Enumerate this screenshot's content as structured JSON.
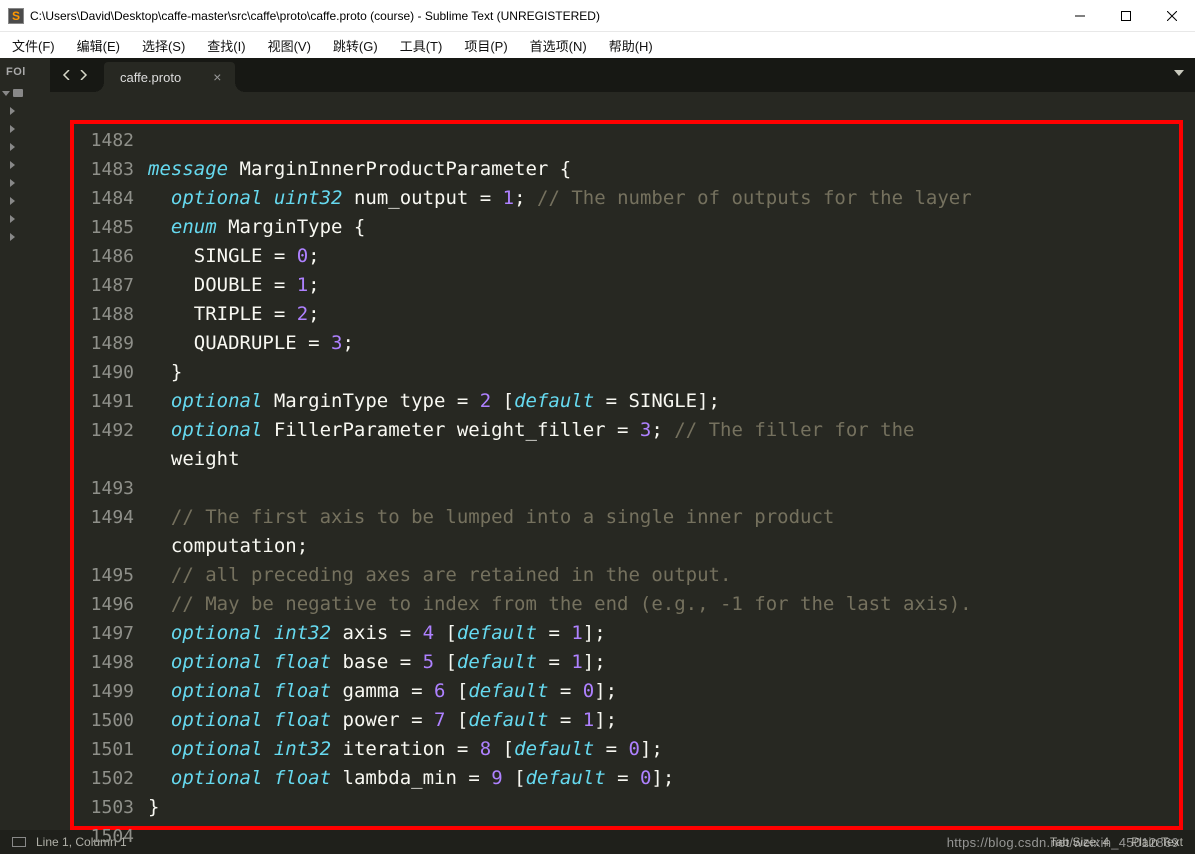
{
  "title": "C:\\Users\\David\\Desktop\\caffe-master\\src\\caffe\\proto\\caffe.proto (course) - Sublime Text (UNREGISTERED)",
  "app_icon_letter": "S",
  "menu": {
    "file": "文件(F)",
    "edit": "编辑(E)",
    "select": "选择(S)",
    "find": "查找(I)",
    "view": "视图(V)",
    "goto": "跳转(G)",
    "tools": "工具(T)",
    "project": "项目(P)",
    "prefs": "首选项(N)",
    "help": "帮助(H)"
  },
  "sidebar_header": "FOl",
  "tab": {
    "name": "caffe.proto"
  },
  "gutter_start": 1482,
  "gutter_end": 1504,
  "code_lines": [
    "",
    "message MarginInnerProductParameter {",
    "  optional uint32 num_output = 1; // The number of outputs for the layer",
    "  enum MarginType {",
    "    SINGLE = 0;",
    "    DOUBLE = 1;",
    "    TRIPLE = 2;",
    "    QUADRUPLE = 3;",
    "  }",
    "  optional MarginType type = 2 [default = SINGLE];",
    "  optional FillerParameter weight_filler = 3; // The filler for the",
    "  weight",
    "",
    "  // The first axis to be lumped into a single inner product",
    "  computation;",
    "  // all preceding axes are retained in the output.",
    "  // May be negative to index from the end (e.g., -1 for the last axis).",
    "  optional int32 axis = 4 [default = 1];",
    "  optional float base = 5 [default = 1];",
    "  optional float gamma = 6 [default = 0];",
    "  optional float power = 7 [default = 1];",
    "  optional int32 iteration = 8 [default = 0];",
    "  optional float lambda_min = 9 [default = 0];",
    "}",
    ""
  ],
  "wrapped_after": {
    "10": true,
    "13": true
  },
  "status": {
    "left": "Line 1, Column 1",
    "tab_size": "Tab Size: 4",
    "syntax": "Plain Text"
  },
  "watermark": "https://blog.csdn.net/weixin_45012869"
}
